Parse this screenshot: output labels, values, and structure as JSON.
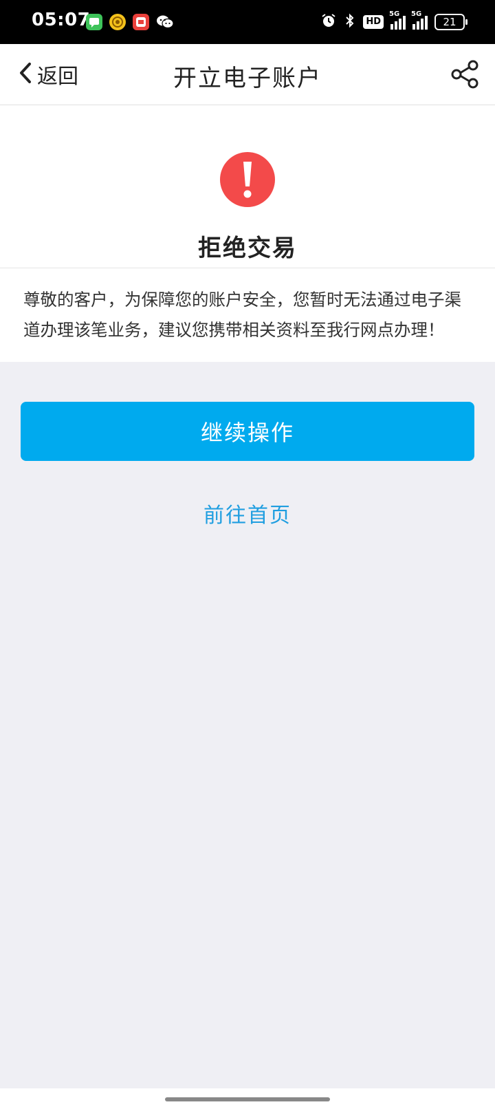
{
  "status_bar": {
    "time": "05:07",
    "hd_label": "HD",
    "network_label_1": "5G",
    "network_label_2": "5G",
    "battery": "21",
    "icons": [
      "messages-app-icon",
      "coin-app-icon",
      "shop-app-icon",
      "wechat-icon",
      "alarm-icon",
      "bluetooth-icon"
    ]
  },
  "nav": {
    "back_label": "返回",
    "title": "开立电子账户",
    "share_icon": "share-icon"
  },
  "result": {
    "icon": "exclamation-icon",
    "icon_color": "#f34a4a",
    "title": "拒绝交易",
    "message": "尊敬的客户，为保障您的账户安全，您暂时无法通过电子渠道办理该笔业务，建议您携带相关资料至我行网点办理！"
  },
  "actions": {
    "continue_label": "继续操作",
    "continue_color": "#00aaee",
    "home_label": "前往首页",
    "home_color": "#1f9ee0"
  }
}
